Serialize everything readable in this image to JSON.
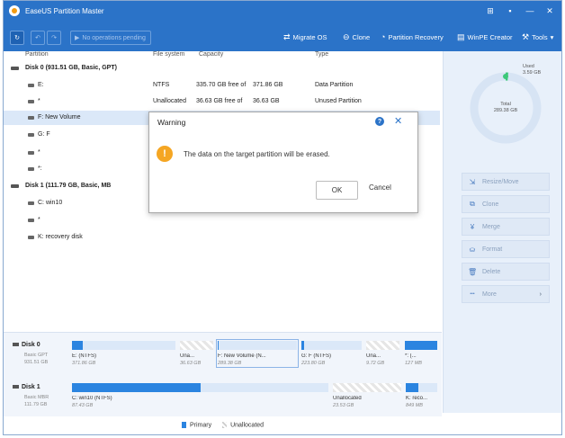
{
  "titlebar": {
    "title": "EaseUS Partition Master",
    "controls": [
      "⊞",
      "▪",
      "—",
      "✕"
    ]
  },
  "toolbar": {
    "pending": "No operations pending",
    "items": [
      {
        "icon": "migrate-icon",
        "label": "Migrate OS"
      },
      {
        "icon": "clone-icon",
        "label": "Clone"
      },
      {
        "icon": "partition-recovery-icon",
        "label": "Partition Recovery"
      },
      {
        "icon": "winpe-icon",
        "label": "WinPE Creator"
      },
      {
        "icon": "tools-icon",
        "label": "Tools"
      }
    ]
  },
  "columns": {
    "partition": "Partition",
    "filesystem": "File system",
    "capacity": "Capacity",
    "type": "Type"
  },
  "tree": [
    {
      "kind": "disk",
      "name": "Disk 0 (931.51 GB, Basic, GPT)"
    },
    {
      "kind": "part",
      "name": "E:",
      "fs": "NTFS",
      "free": "335.70 GB free of",
      "total": "371.86 GB",
      "type": "Data Partition"
    },
    {
      "kind": "part",
      "name": "*",
      "fs": "Unallocated",
      "free": "36.63 GB free of",
      "total": "36.63 GB",
      "type": "Unused Partition"
    },
    {
      "kind": "part",
      "name": "F: New Volume",
      "fs": "",
      "free": "",
      "total": "",
      "type": "",
      "selected": true
    },
    {
      "kind": "part",
      "name": "G: F",
      "fs": "",
      "free": "",
      "total": "",
      "type": ""
    },
    {
      "kind": "part",
      "name": "*",
      "fs": "",
      "free": "",
      "total": "",
      "type": ""
    },
    {
      "kind": "part",
      "name": "*:",
      "fs": "",
      "free": "",
      "total": "",
      "type": ""
    },
    {
      "kind": "disk",
      "name": "Disk 1 (111.79 GB, Basic, MB"
    },
    {
      "kind": "part",
      "name": "C: win10",
      "fs": "",
      "free": "",
      "total": "",
      "type": ""
    },
    {
      "kind": "part",
      "name": "*",
      "fs": "",
      "free": "",
      "total": "",
      "type": ""
    },
    {
      "kind": "part",
      "name": "K: recovery disk",
      "fs": "",
      "free": "",
      "total": "",
      "type": ""
    }
  ],
  "sidepanel": {
    "used_label": "Used",
    "used_value": "3.59 GB",
    "total_label": "Total",
    "total_value": "289.38 GB",
    "used_fraction": 0.012,
    "actions": [
      {
        "icon": "resize-move-icon",
        "glyph": "⇲",
        "label": "Resize/Move"
      },
      {
        "icon": "clone-icon",
        "glyph": "⧉",
        "label": "Clone"
      },
      {
        "icon": "merge-icon",
        "glyph": "¥",
        "label": "Merge"
      },
      {
        "icon": "format-icon",
        "glyph": "⛀",
        "label": "Format"
      },
      {
        "icon": "delete-icon",
        "glyph": "🗑",
        "label": "Delete"
      },
      {
        "icon": "more-icon",
        "glyph": "•••",
        "label": "More"
      }
    ]
  },
  "diskmap": {
    "disk0": {
      "label": "Disk 0",
      "type": "Basic GPT",
      "size": "931.51 GB",
      "segments": [
        {
          "name": "E: (NTFS)",
          "size": "371.86 GB",
          "used": 0.1,
          "unalloc": false
        },
        {
          "name": "Una...",
          "size": "36.63 GB",
          "used": 0,
          "unalloc": true
        },
        {
          "name": "F: New Volume (N...",
          "size": "289.38 GB",
          "used": 0.012,
          "unalloc": false,
          "selected": true
        },
        {
          "name": "G: F (NTFS)",
          "size": "223.80 GB",
          "used": 0.05,
          "unalloc": false
        },
        {
          "name": "Una...",
          "size": "9.72 GB",
          "used": 0,
          "unalloc": true
        },
        {
          "name": "*: (...",
          "size": "127 MB",
          "used": 1,
          "unalloc": false
        }
      ]
    },
    "disk1": {
      "label": "Disk 1",
      "type": "Basic MBR",
      "size": "111.79 GB",
      "segments": [
        {
          "name": "C: win10 (NTFS)",
          "size": "87.43 GB",
          "used": 0.5,
          "unalloc": false
        },
        {
          "name": "Unallocated",
          "size": "23.53 GB",
          "used": 0,
          "unalloc": true
        },
        {
          "name": "K: reco...",
          "size": "849 MB",
          "used": 0.4,
          "unalloc": false
        }
      ]
    }
  },
  "legend": {
    "primary": "Primary",
    "unallocated": "Unallocated",
    "primary_color": "#2b84e0"
  },
  "dialog": {
    "title": "Warning",
    "message": "The data on the target partition will be erased.",
    "ok": "OK",
    "cancel": "Cancel"
  }
}
